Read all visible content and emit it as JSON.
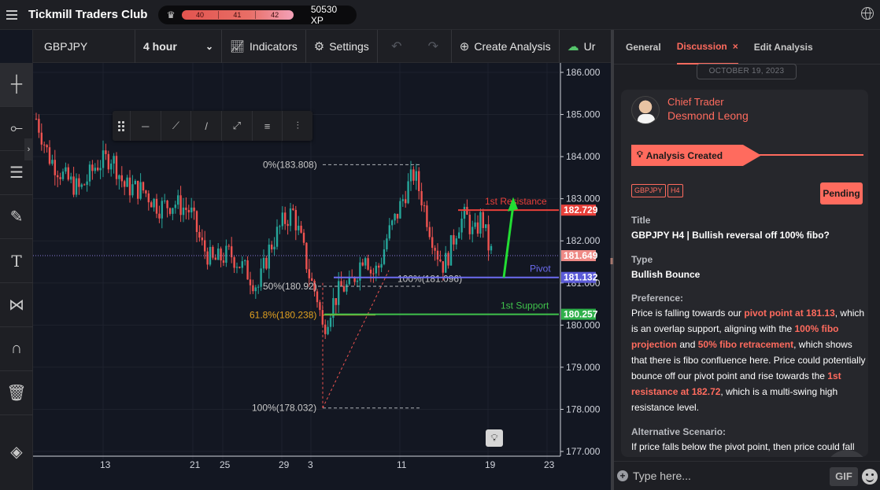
{
  "header": {
    "brand": "Tickmill Traders Club",
    "xp_levels": [
      "40",
      "41",
      "42"
    ],
    "xp_value": "50530 XP"
  },
  "toolbar": {
    "symbol": "GBPJPY",
    "interval": "4 hour",
    "indicators_label": "Indicators",
    "settings_label": "Settings",
    "create_label": "Create Analysis",
    "cloud_label": "Ur"
  },
  "chart_data": {
    "type": "candlestick",
    "symbol": "GBPJPY",
    "interval": "4 hour",
    "y_ticks": [
      "186.000",
      "185.000",
      "184.000",
      "183.000",
      "182.000",
      "181.000",
      "180.000",
      "179.000",
      "178.000",
      "177.000"
    ],
    "y_tick_values": [
      186,
      185,
      184,
      183,
      182,
      181,
      180,
      179,
      178,
      177
    ],
    "x_ticks": [
      "13",
      "21",
      "25",
      "29",
      "3",
      "11",
      "19",
      "23"
    ],
    "ylim": [
      176.95,
      186.3
    ],
    "price_labels": {
      "resistance": "182.729",
      "current": "181.649",
      "pivot": "181.132",
      "support": "180.257"
    },
    "levels": [
      {
        "name": "1st Resistance",
        "value": 182.729,
        "color": "#e8403a"
      },
      {
        "name": "Pivot",
        "value": 181.132,
        "color": "#6c6cf0"
      },
      {
        "name": "1st Support",
        "value": 180.257,
        "color": "#3fc24b"
      }
    ],
    "fib_labels": [
      {
        "text": "0%(183.808)",
        "value": 183.808,
        "color": "#c8c8c8"
      },
      {
        "text": "50%(180.92)",
        "value": 180.92,
        "color": "#c8c8c8"
      },
      {
        "text": "100%(181.096)",
        "value": 181.096,
        "color": "#c8c8c8"
      },
      {
        "text": "61.8%(180.238)",
        "value": 180.238,
        "color": "#e0a020"
      },
      {
        "text": "100%(178.032)",
        "value": 178.032,
        "color": "#c8c8c8"
      }
    ],
    "current_price": 181.649,
    "colors": {
      "up": "#26a69a",
      "down": "#ef5350"
    }
  },
  "panel": {
    "tabs": [
      "General",
      "Discussion",
      "Edit Analysis"
    ],
    "close_glyph": "×",
    "date": "OCTOBER 19, 2023",
    "author_role": "Chief Trader",
    "author_name": "Desmond Leong",
    "created_label": "Analysis Created",
    "tags": [
      "GBPJPY",
      "H4"
    ],
    "status": "Pending",
    "title_label": "Title",
    "title_value": "GBPJPY H4 | Bullish reversal off 100% fibo?",
    "type_label": "Type",
    "type_value": "Bullish Bounce",
    "preference_label": "Preference:",
    "pref": {
      "p1": "Price is falling towards our ",
      "h1": "pivot point at 181.13",
      "p2": ", which is an overlap support, aligning with the ",
      "h2": "100% fibo projection",
      "p3": " and ",
      "h3": "50% fibo retracement",
      "p4": ", which shows that there is fibo confluence here. Price could potentially bounce off our pivot point and rise towards the ",
      "h4": "1st resistance at 182.72",
      "p5": ", which is a multi-swing high resistance level."
    },
    "alt_label": "Alternative Scenario:",
    "alt_text": "If price falls below the pivot point, then price could fall",
    "composer_placeholder": "Type here...",
    "gif_label": "GIF"
  }
}
